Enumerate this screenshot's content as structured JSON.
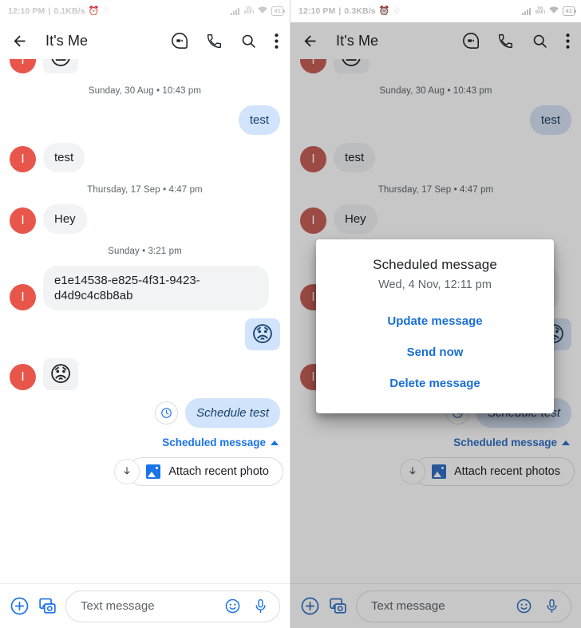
{
  "panels": {
    "left": {
      "status": {
        "time": "12:10 PM",
        "sep": "|",
        "net_speed": "0.1KB/s",
        "alarm_icon": "alarm-icon",
        "headset_icon": "headset-icon",
        "signal_icon": "signal-bars-icon",
        "vowifi_line1": "Vo",
        "vowifi_line2": "WiFi",
        "wifi_icon": "wifi-icon",
        "battery_level": "41"
      },
      "appbar": {
        "back_icon": "back-arrow-icon",
        "title": "It's Me",
        "video_icon": "video-call-icon",
        "call_icon": "phone-call-icon",
        "search_icon": "search-icon",
        "overflow_icon": "more-vert-icon"
      },
      "chip_label": "Attach recent photo"
    },
    "right": {
      "status": {
        "time": "12:10 PM",
        "sep": "|",
        "net_speed": "0.3KB/s",
        "alarm_icon": "alarm-icon",
        "headset_icon": "headset-icon",
        "signal_icon": "signal-bars-icon",
        "vowifi_line1": "Vo",
        "vowifi_line2": "WiFi",
        "wifi_icon": "wifi-icon",
        "battery_level": "41"
      },
      "appbar": {
        "back_icon": "back-arrow-icon",
        "title": "It's Me",
        "video_icon": "video-call-icon",
        "call_icon": "phone-call-icon",
        "search_icon": "search-icon",
        "overflow_icon": "more-vert-icon"
      },
      "chip_label": "Attach recent photos"
    }
  },
  "thread": {
    "avatar_initial": "I",
    "partial_emoji": "😐",
    "sep1": "Sunday, 30 Aug • 10:43 pm",
    "msg_out_test": "test",
    "msg_in_test": "test",
    "sep2": "Thursday, 17 Sep • 4:47 pm",
    "msg_in_hey": "Hey",
    "sep3": "Sunday • 3:21 pm",
    "msg_in_uuid": "e1e14538-e825-4f31-9423-d4d9c4c8b8ab",
    "emoji_out": "😟",
    "emoji_in": "😟",
    "clock_icon": "clock-icon",
    "msg_sched": "Schedule test",
    "sched_label": "Scheduled message",
    "chevron_icon": "chevron-up-icon",
    "download_icon": "download-arrow-icon",
    "photo_icon": "photo-icon"
  },
  "composer": {
    "plus_icon": "plus-circle-icon",
    "gallery_icon": "gallery-camera-icon",
    "placeholder": "Text message",
    "emoji_icon": "emoji-icon",
    "mic_icon": "microphone-icon"
  },
  "dialog": {
    "title": "Scheduled message",
    "subtitle": "Wed, 4 Nov, 12:11 pm",
    "action_update": "Update message",
    "action_send": "Send now",
    "action_delete": "Delete message"
  },
  "colors": {
    "accent_blue": "#1a73e8",
    "bubble_out": "#d2e3fc",
    "bubble_in": "#f1f3f4",
    "avatar_red": "#e8564b",
    "text_primary": "#202124",
    "text_secondary": "#5f6368"
  }
}
